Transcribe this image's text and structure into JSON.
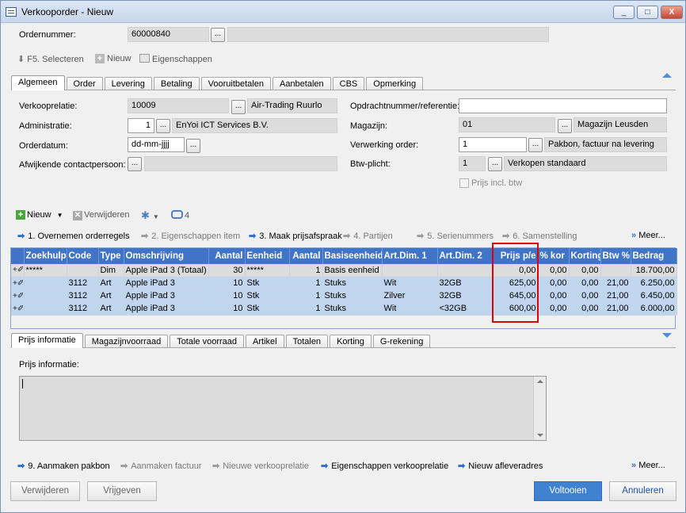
{
  "window": {
    "title": "Verkooporder - Nieuw",
    "controls": [
      "_",
      "□",
      "X"
    ]
  },
  "header": {
    "ordernummer_label": "Ordernummer:",
    "ordernummer_value": "60000840"
  },
  "toolbar": {
    "f5_label": "F5. Selecteren",
    "nieuw_label": "Nieuw",
    "eigenschappen_label": "Eigenschappen"
  },
  "main_tabs": [
    "Algemeen",
    "Order",
    "Levering",
    "Betaling",
    "Vooruitbetalen",
    "Aanbetalen",
    "CBS",
    "Opmerking"
  ],
  "form": {
    "verkooprelatie_label": "Verkooprelatie:",
    "verkooprelatie_code": "10009",
    "verkooprelatie_name": "Air-Trading Ruurlo",
    "administratie_label": "Administratie:",
    "administratie_value": "1",
    "administratie_name": "EnYoi ICT Services B.V.",
    "orderdatum_label": "Orderdatum:",
    "orderdatum_value": "dd-mm-jjjj",
    "afwijkende_label": "Afwijkende contactpersoon:",
    "opdrachtnummer_label": "Opdrachtnummer/referentie:",
    "opdrachtnummer_value": "",
    "magazijn_label": "Magazijn:",
    "magazijn_code": "01",
    "magazijn_name": "Magazijn Leusden",
    "verwerking_label": "Verwerking order:",
    "verwerking_code": "1",
    "verwerking_name": "Pakbon, factuur na levering",
    "btw_label": "Btw-plicht:",
    "btw_code": "1",
    "btw_name": "Verkopen standaard",
    "prijs_incl_label": "Prijs incl. btw"
  },
  "line_toolbar": {
    "nieuw": "Nieuw",
    "verwijderen": "Verwijderen",
    "count": "4"
  },
  "steps": [
    {
      "label": "1. Overnemen orderregels",
      "enabled": true
    },
    {
      "label": "2. Eigenschappen item",
      "enabled": false
    },
    {
      "label": "3. Maak prijsafspraak",
      "enabled": true
    },
    {
      "label": "4. Partijen",
      "enabled": false
    },
    {
      "label": "5. Serienummers",
      "enabled": false
    },
    {
      "label": "6. Samenstelling",
      "enabled": false
    }
  ],
  "steps_more": "Meer...",
  "grid": {
    "columns": [
      "Zoekhulp",
      "Code",
      "Type",
      "Omschrijving",
      "Aantal",
      "Eenheid",
      "Aantal",
      "Basiseenheid",
      "Art.Dim. 1",
      "Art.Dim. 2",
      "Prijs p/e",
      "% kor",
      "Korting",
      "Btw %",
      "Bedrag"
    ],
    "rows": [
      {
        "zoekhulp": "*****",
        "code": "",
        "type": "Dim",
        "omschrijving": "Apple iPad 3 (Totaal)",
        "aantal": "30",
        "eenheid": "*****",
        "aantal2": "1",
        "basiseenheid": "Basis eenheid",
        "dim1": "",
        "dim2": "",
        "prijs": "0,00",
        "kor": "0,00",
        "korting": "0,00",
        "btw": "",
        "bedrag": "18.700,00"
      },
      {
        "zoekhulp": "",
        "code": "3112",
        "type": "Art",
        "omschrijving": "Apple iPad 3",
        "aantal": "10",
        "eenheid": "Stk",
        "aantal2": "1",
        "basiseenheid": "Stuks",
        "dim1": "Wit",
        "dim2": "32GB",
        "prijs": "625,00",
        "kor": "0,00",
        "korting": "0,00",
        "btw": "21,00",
        "bedrag": "6.250,00"
      },
      {
        "zoekhulp": "",
        "code": "3112",
        "type": "Art",
        "omschrijving": "Apple iPad 3",
        "aantal": "10",
        "eenheid": "Stk",
        "aantal2": "1",
        "basiseenheid": "Stuks",
        "dim1": "Zilver",
        "dim2": "32GB",
        "prijs": "645,00",
        "kor": "0,00",
        "korting": "0,00",
        "btw": "21,00",
        "bedrag": "6.450,00"
      },
      {
        "zoekhulp": "",
        "code": "3112",
        "type": "Art",
        "omschrijving": "Apple iPad 3",
        "aantal": "10",
        "eenheid": "Stk",
        "aantal2": "1",
        "basiseenheid": "Stuks",
        "dim1": "Wit",
        "dim2": "<32GB",
        "prijs": "600,00",
        "kor": "0,00",
        "korting": "0,00",
        "btw": "21,00",
        "bedrag": "6.000,00"
      }
    ]
  },
  "bottom_tabs": [
    "Prijs informatie",
    "Magazijnvoorraad",
    "Totale voorraad",
    "Artikel",
    "Totalen",
    "Korting",
    "G-rekening"
  ],
  "prijs_info_label": "Prijs informatie:",
  "actions": [
    {
      "label": "9. Aanmaken pakbon",
      "enabled": true
    },
    {
      "label": "Aanmaken factuur",
      "enabled": false
    },
    {
      "label": "Nieuwe verkooprelatie",
      "enabled": false
    },
    {
      "label": "Eigenschappen verkooprelatie",
      "enabled": true
    },
    {
      "label": "Nieuw afleveradres",
      "enabled": true
    }
  ],
  "actions_more": "Meer...",
  "buttons": {
    "verwijderen": "Verwijderen",
    "vrijgeven": "Vrijgeven",
    "voltooien": "Voltooien",
    "annuleren": "Annuleren"
  },
  "colors": {
    "grid_header": "#3f74c6",
    "selected_row": "#c0d6ee",
    "highlight_box": "#e00000",
    "primary_button": "#3f82d2"
  }
}
